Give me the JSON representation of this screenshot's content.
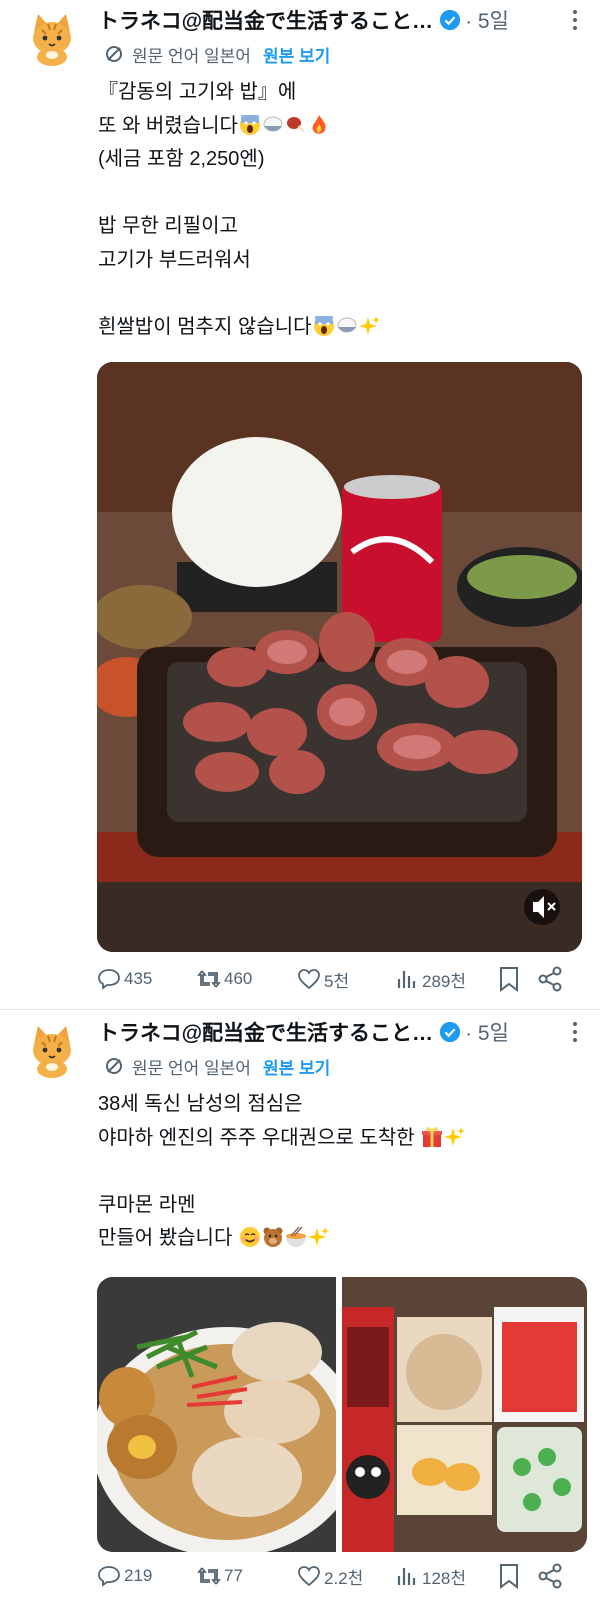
{
  "tweets": [
    {
      "author": "トラネコ@配当金で生活すること…",
      "time": "· 5일",
      "translate": {
        "label": "원문 언어 일본어",
        "link": "원본 보기"
      },
      "lines": [
        "『감동의 고기와 밥』에",
        "또 와 버렸습니다",
        "(세금 포함 2,250엔)",
        "",
        "밥 무한 리필이고",
        "고기가 부드러워서",
        "",
        "흰쌀밥이 멈추지 않습니다"
      ],
      "emoji_names": [
        "scream-emoji",
        "rice-emoji",
        "meat-emoji",
        "fire-emoji",
        "sparkles-emoji"
      ],
      "actions": {
        "replies": "435",
        "reposts": "460",
        "likes": "5천",
        "views": "289천"
      }
    },
    {
      "author": "トラネコ@配当金で生活すること…",
      "time": "· 5일",
      "translate": {
        "label": "원문 언어 일본어",
        "link": "원본 보기"
      },
      "lines": [
        "38세 독신 남성의 점심은",
        "야마하 엔진의 주주 우대권으로 도착한",
        "",
        "쿠마몬 라멘",
        "만들어 봤습니다"
      ],
      "emoji_names": [
        "gift-emoji",
        "sparkles-emoji",
        "smile-emoji",
        "bear-emoji",
        "ramen-emoji",
        "sparkles-emoji"
      ],
      "actions": {
        "replies": "219",
        "reposts": "77",
        "likes": "2.2천",
        "views": "128천"
      }
    }
  ],
  "colors": {
    "accent": "#1d9bf0",
    "secondary_text": "#536471",
    "text": "#0f1419"
  }
}
